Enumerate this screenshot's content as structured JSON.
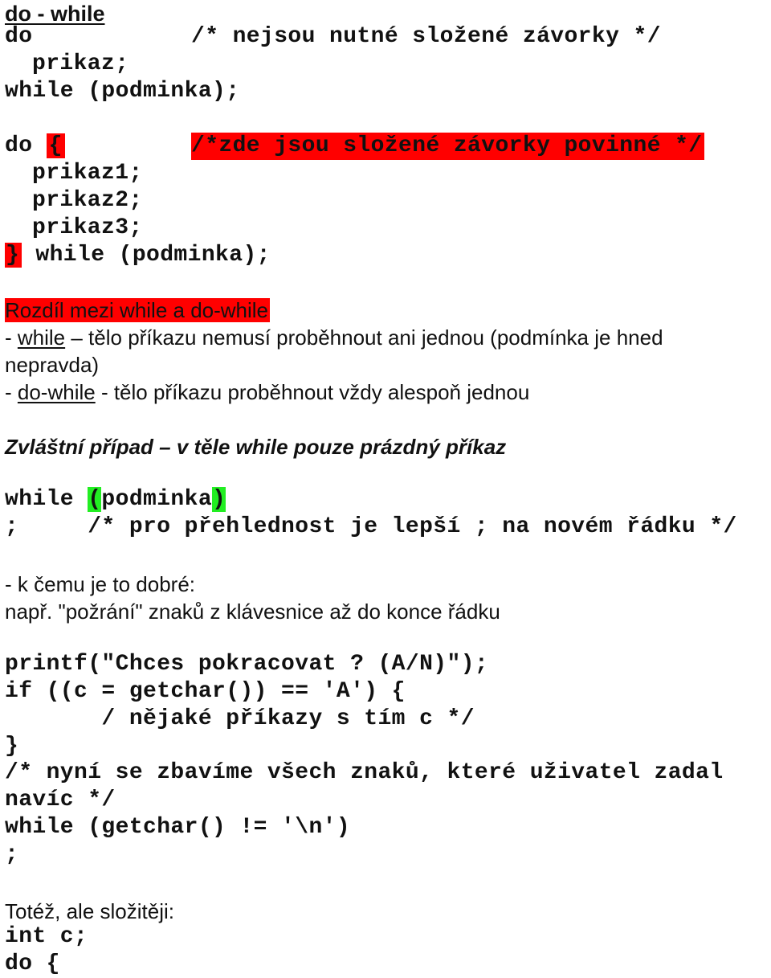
{
  "heading": "do - while",
  "block1": {
    "line1_kw": "do",
    "line1_comment": "/* nejsou nutné složené závorky */",
    "line2": "prikaz;",
    "line3": "while (podminka);"
  },
  "block2": {
    "line1_kw": "do ",
    "line1_brace": "{",
    "line1_comment": "/*zde jsou složené závorky povinné */",
    "line2": "prikaz1;",
    "line3": "prikaz2;",
    "line4": "prikaz3;",
    "line5_brace": "}",
    "line5_rest": " while (podminka);"
  },
  "difference": {
    "title": "Rozdíl mezi while a do-while",
    "item1_prefix": "- ",
    "item1_kw": "while",
    "item1_text": " – tělo příkazu nemusí proběhnout ani jednou (podmínka je hned",
    "item1_cont": "nepravda)",
    "item2_prefix": "- ",
    "item2_kw": "do-while",
    "item2_text": " - tělo příkazu proběhnout vždy alespoň jednou"
  },
  "special": {
    "title": "Zvláštní případ – v těle while pouze prázdný příkaz",
    "code1_kw": "while ",
    "code1_open": "(",
    "code1_mid": "podminka",
    "code1_close": ")",
    "code2": ";     /* pro přehlednost je lepší ; na novém řádku */"
  },
  "usage": {
    "line1": "- k čemu je to dobré:",
    "line2": "např. \"požrání\" znaků z klávesnice až do konce řádku"
  },
  "example": {
    "lines": [
      "printf(\"Chces pokracovat ? (A/N)\");",
      "if ((c = getchar()) == 'A') {",
      "       / nějaké příkazy s tím c */",
      "}",
      "/* nyní se zbavíme všech znaků, které uživatel zadal",
      "navíc */",
      "while (getchar() != '\\n')",
      ";"
    ]
  },
  "alt": {
    "title": "Totéž, ale složitěji:",
    "line1": "int c;",
    "line2": "do {"
  }
}
